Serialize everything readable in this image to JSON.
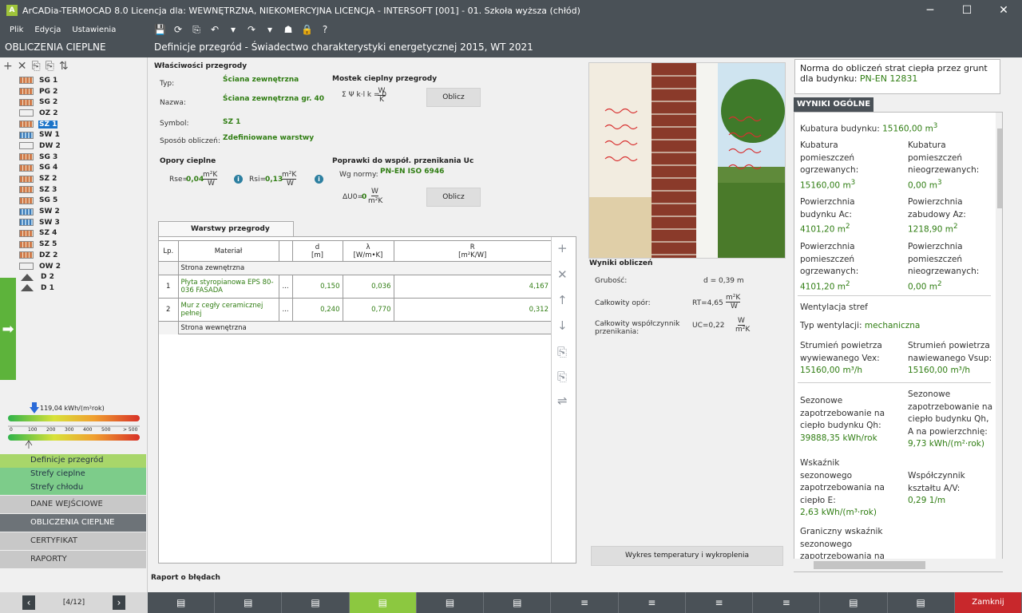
{
  "window": {
    "title": "ArCADia-TERMOCAD 8.0 Licencja dla: WEWNĘTRZNA, NIEKOMERCYJNA LICENCJA - INTERSOFT [001] - 01. Szkoła wyższa (chłód)",
    "minimize": "─",
    "maximize": "☐",
    "close": "✕"
  },
  "menu": [
    "Plik",
    "Edycja",
    "Ustawienia"
  ],
  "toolbar": [
    "💾",
    "⟳",
    "⎘",
    "↶",
    "▾",
    "↷",
    "▾",
    "☗",
    "🔒",
    "?"
  ],
  "section_title": "OBLICZENIA CIEPLNE",
  "page_title": "Definicje przegród - Świadectwo charakterystyki energetycznej 2015, WT 2021",
  "tree_tools": [
    "+",
    "✕",
    "⎘",
    "⎘",
    "⇅"
  ],
  "tree": [
    {
      "label": "SG 1",
      "icon": "brick"
    },
    {
      "label": "PG 2",
      "icon": "brick"
    },
    {
      "label": "SG 2",
      "icon": "brick"
    },
    {
      "label": "OZ 2",
      "icon": "window"
    },
    {
      "label": "SZ 1",
      "icon": "brick",
      "selected": true
    },
    {
      "label": "SW 1",
      "icon": "blue"
    },
    {
      "label": "DW 2",
      "icon": "door"
    },
    {
      "label": "SG 3",
      "icon": "brick"
    },
    {
      "label": "SG 4",
      "icon": "brick"
    },
    {
      "label": "SZ 2",
      "icon": "brick"
    },
    {
      "label": "SZ 3",
      "icon": "brick"
    },
    {
      "label": "SG 5",
      "icon": "brick"
    },
    {
      "label": "SW 2",
      "icon": "blue"
    },
    {
      "label": "SW 3",
      "icon": "blue"
    },
    {
      "label": "SZ 4",
      "icon": "brick"
    },
    {
      "label": "SZ 5",
      "icon": "brick"
    },
    {
      "label": "DZ 2",
      "icon": "brick"
    },
    {
      "label": "OW 2",
      "icon": "window"
    },
    {
      "label": "D 2",
      "icon": "roof"
    },
    {
      "label": "D 1",
      "icon": "roof"
    }
  ],
  "energy_scale": {
    "value_label": "119,04 kWh/(m²rok)",
    "value": 119.04,
    "ticks": [
      "0",
      "100",
      "200",
      "300",
      "400",
      "500",
      "> 500"
    ]
  },
  "nav": {
    "sub": [
      "Definicje przegród",
      "Strefy cieplne",
      "Strefy chłodu"
    ],
    "main": [
      "DANE WEJŚCIOWE",
      "OBLICZENIA CIEPLNE",
      "CERTYFIKAT",
      "RAPORTY"
    ]
  },
  "pager": {
    "prev": "‹",
    "text": "[4/12]",
    "next": "›"
  },
  "props": {
    "heading": "Właściwości przegrody",
    "typ_label": "Typ:",
    "typ": "Ściana zewnętrzna",
    "nazwa_label": "Nazwa:",
    "nazwa": "Ściana zewnętrzna gr. 40",
    "symbol_label": "Symbol:",
    "symbol": "SZ 1",
    "sposob_label": "Sposób obliczeń:",
    "sposob": "Zdefiniowane warstwy",
    "mostek_heading": "Mostek cieplny przegrody",
    "mostek_formula": "Σ Ψ k·l k = 0",
    "mostek_unit_num": "W",
    "mostek_unit_den": "K",
    "oblicz": "Oblicz",
    "opory_heading": "Opory cieplne",
    "rse": "Rse=",
    "rse_val": "0,04",
    "rsi": "Rsi=",
    "rsi_val": "0,13",
    "unit_num": "m²K",
    "unit_den": "W",
    "info_icon": "i",
    "poprawki_heading": "Poprawki do współ. przenikania Uc",
    "wg_normy_label": "Wg normy:",
    "wg_normy": "PN-EN ISO 6946",
    "du_label": "ΔU0=",
    "du_val": "0",
    "du_unit_num": "W",
    "du_unit_den": "m²K"
  },
  "layers": {
    "tab": "Warstwy przegrody",
    "headers": [
      "Lp.",
      "Materiał",
      "",
      "d\n[m]",
      "λ\n[W/m•K]",
      "R\n[m²K/W]"
    ],
    "outer": "Strona zewnętrzna",
    "inner": "Strona wewnętrzna",
    "rows": [
      {
        "lp": "1",
        "material": "Płyta styropianowa EPS 80-036 FASADA",
        "more": "...",
        "d": "0,150",
        "lambda": "0,036",
        "r": "4,167"
      },
      {
        "lp": "2",
        "material": "Mur z cegły ceramicznej pełnej",
        "more": "...",
        "d": "0,240",
        "lambda": "0,770",
        "r": "0,312"
      }
    ],
    "side_buttons": [
      "+",
      "✕",
      "↑",
      "↓",
      "⎘",
      "⎘",
      "⇌"
    ]
  },
  "results": {
    "heading": "Wyniki obliczeń",
    "grubosc_label": "Grubość:",
    "grubosc": "d = 0,39 m",
    "opor_label": "Całkowity opór:",
    "opor": "RT=4,65",
    "opor_unit_num": "m²K",
    "opor_unit_den": "W",
    "wsp_label": "Całkowity współczynnik przenikania:",
    "wsp": "UC=0,22",
    "wsp_unit_num": "W",
    "wsp_unit_den": "m²K",
    "chart_button": "Wykres temperatury i wykroplenia"
  },
  "error_label": "Raport o błędach",
  "right": {
    "norma": "Norma do obliczeń strat ciepła przez grunt dla budynku: ",
    "norma_val": "PN-EN 12831",
    "tab": "WYNIKI OGÓLNE",
    "kubatura": "Kubatura budynku: ",
    "kubatura_val": "15160,00 m",
    "k_ogrz": "Kubatura pomieszczeń ogrzewanych:",
    "k_ogrz_val": "15160,00 m",
    "k_nieogrz": "Kubatura pomieszczeń nieogrzewanych:",
    "k_nieogrz_val": "0,00 m",
    "pow_ac": "Powierzchnia budynku Ac:",
    "pow_ac_val": "4101,20 m",
    "pow_az": "Powierzchnia zabudowy Az:",
    "pow_az_val": "1218,90 m",
    "pow_ogrz": "Powierzchnia pomieszczeń ogrzewanych:",
    "pow_ogrz_val": "4101,20 m",
    "pow_nieogrz": "Powierzchnia pomieszczeń nieogrzewanych:",
    "pow_nieogrz_val": "0,00 m",
    "wentylacja": "Wentylacja stref",
    "typ_went": "Typ wentylacji: ",
    "typ_went_val": "mechaniczna",
    "strumien_wyw": "Strumień powietrza wywiewanego Vex:",
    "strumien_wyw_val": "15160,00 m³/h",
    "strumien_naw": "Strumień powietrza nawiewanego Vsup:",
    "strumien_naw_val": "15160,00 m³/h",
    "sez_qh": "Sezonowe zapotrzebowanie na ciepło budynku Qh:",
    "sez_qh_val": "39888,35 kWh/rok",
    "sez_qha": "Sezonowe zapotrzebowanie na ciepło budynku Qh, A na powierzchnię:",
    "sez_qha_val": "9,73 kWh/(m²·rok)",
    "wsk_e": "Wskaźnik sezonowego zapotrzebowania na ciepło E:",
    "wsk_e_val": "2,63 kWh/(m³·rok)",
    "wsp_ksz": "Współczynnik kształtu A/V:",
    "wsp_ksz_val": "0,29 1/m",
    "graniczny": "Graniczny wskaźnik sezonowego zapotrzebowania na"
  },
  "bottom_buttons": [
    "▤",
    "▤",
    "▤",
    "▤",
    "▤",
    "▤",
    "≡",
    "≡",
    "≡",
    "≡",
    "▤",
    "▤",
    "Zamknij"
  ],
  "colors": {
    "dark": "#4a5157",
    "green": "#2f7d12",
    "accent": "#8cc840",
    "close": "#c8282c"
  }
}
